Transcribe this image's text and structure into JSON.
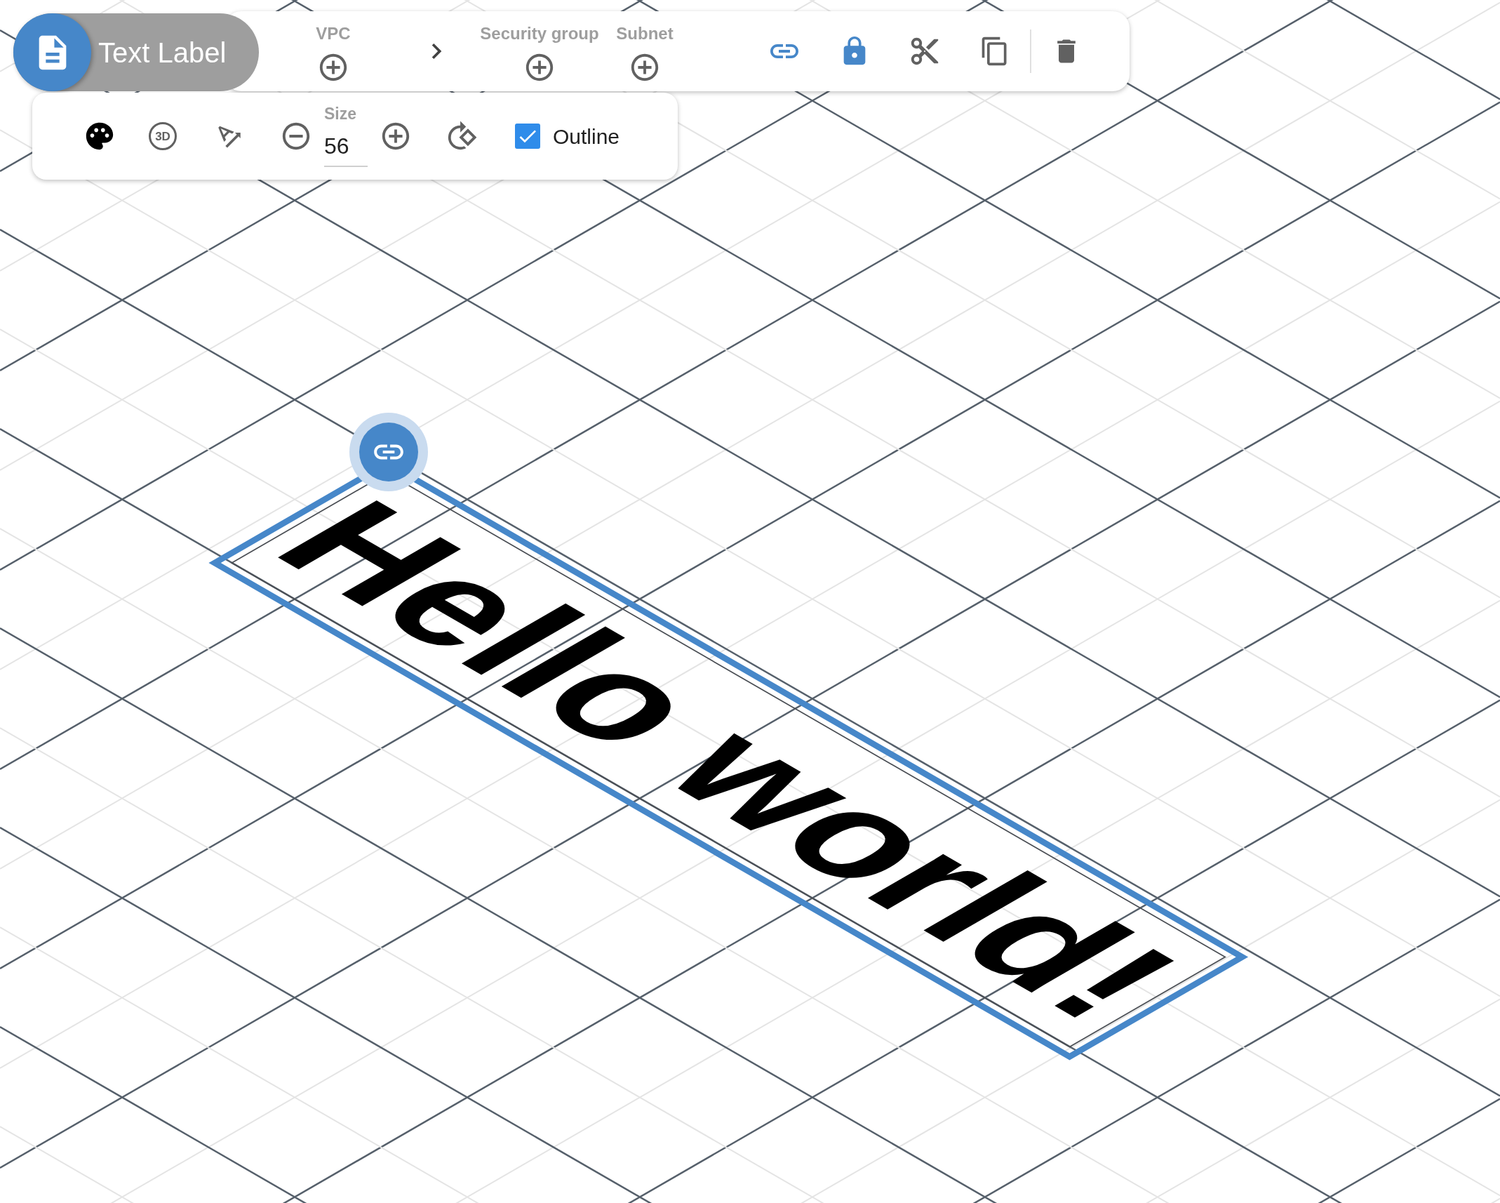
{
  "node": {
    "title": "Text Label"
  },
  "breadcrumb": [
    {
      "label": "VPC"
    },
    {
      "label": "Security group"
    },
    {
      "label": "Subnet"
    }
  ],
  "actions": {
    "linked": true,
    "locked": true
  },
  "style_toolbar": {
    "view_3d": "3D",
    "size_label": "Size",
    "size_value": "56",
    "outline": {
      "label": "Outline",
      "checked": true
    }
  },
  "canvas": {
    "label": {
      "text": "Hello world!",
      "selected": true
    }
  }
}
